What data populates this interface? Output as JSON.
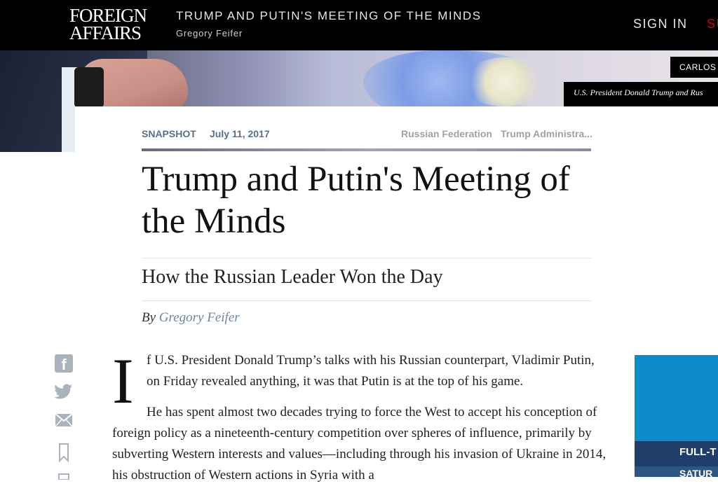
{
  "header": {
    "logo_line1": "FOREIGN",
    "logo_line2": "AFFAIRS",
    "article_title": "TRUMP AND PUTIN'S MEETING OF THE MINDS",
    "article_author": "Gregory Feifer",
    "signin_label": "SIGN IN",
    "subscribe_label": "SU"
  },
  "hero": {
    "photo_credit": "CARLOS",
    "caption": "U.S. President Donald Trump and Rus"
  },
  "article": {
    "section": "SNAPSHOT",
    "date": "July 11, 2017",
    "tags": [
      "Russian Federation",
      "Trump Administra..."
    ],
    "headline": "Trump and Putin's Meeting of the Minds",
    "dek": "How the Russian Leader Won the Day",
    "byline_prefix": "By",
    "byline_author": "Gregory Feifer",
    "dropcap": "I",
    "para1": "f U.S. President Donald Trump’s talks with his Russian counterpart, Vladimir Putin, on Friday revealed anything, it was that Putin is at the top of his game.",
    "para2": "He has spent almost two decades trying to force the West to accept his conception of foreign policy as a nineteenth-century competition over spheres of influence, primarily by subverting Western interests and values—including through his invasion of Ukraine in 2014, his obstruction of Western actions in Syria with a"
  },
  "share": {
    "icons": [
      "facebook-icon",
      "twitter-icon",
      "email-icon",
      "bookmark-icon",
      "print-icon"
    ],
    "facebook_glyph": "f"
  },
  "ad": {
    "line1": "FULL-T",
    "line2": "SATUR"
  },
  "colors": {
    "topbar": "#000000",
    "accent_red": "#d0021b",
    "meta_blue": "#5a6f8a",
    "link_blue": "#6a86a0",
    "ad_blue": "#0e8bc9"
  }
}
